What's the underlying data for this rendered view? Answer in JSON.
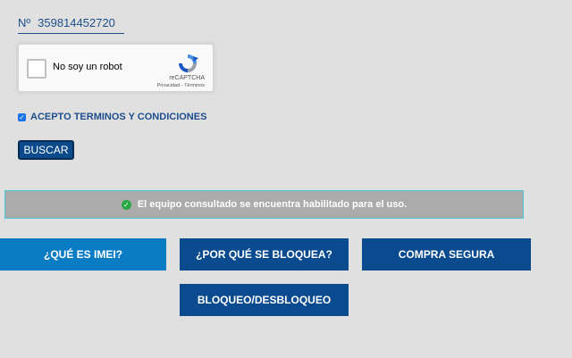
{
  "imei": {
    "prefix": "Nº",
    "value": "359814452720"
  },
  "recaptcha": {
    "label": "No soy un robot",
    "brand": "reCAPTCHA",
    "terms": "Privacidad - Términos"
  },
  "terms": {
    "label": "ACEPTO TERMINOS Y CONDICIONES",
    "checked": true
  },
  "search_button": "BUSCAR",
  "result": {
    "message": "El equipo consultado se encuentra habilitado para el uso.",
    "status_color": "#28a745"
  },
  "nav": {
    "what_is_imei": "¿QUÉ ES IMEI?",
    "why_blocked": "¿POR QUÉ SE BLOQUEA?",
    "safe_purchase": "COMPRA SEGURA",
    "block_unblock": "BLOQUEO/DESBLOQUEO"
  },
  "colors": {
    "primary": "#0a4a8f",
    "accent": "#0a7cc4",
    "background": "#e0e0e0"
  }
}
